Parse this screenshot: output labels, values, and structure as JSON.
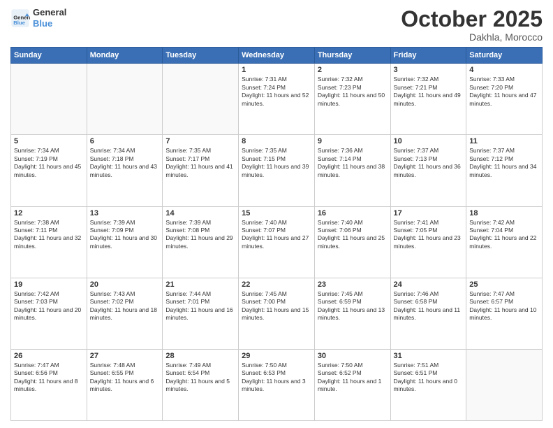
{
  "header": {
    "logo_line1": "General",
    "logo_line2": "Blue",
    "month": "October 2025",
    "location": "Dakhla, Morocco"
  },
  "weekdays": [
    "Sunday",
    "Monday",
    "Tuesday",
    "Wednesday",
    "Thursday",
    "Friday",
    "Saturday"
  ],
  "weeks": [
    [
      {
        "day": "",
        "sunrise": "",
        "sunset": "",
        "daylight": ""
      },
      {
        "day": "",
        "sunrise": "",
        "sunset": "",
        "daylight": ""
      },
      {
        "day": "",
        "sunrise": "",
        "sunset": "",
        "daylight": ""
      },
      {
        "day": "1",
        "sunrise": "Sunrise: 7:31 AM",
        "sunset": "Sunset: 7:24 PM",
        "daylight": "Daylight: 11 hours and 52 minutes."
      },
      {
        "day": "2",
        "sunrise": "Sunrise: 7:32 AM",
        "sunset": "Sunset: 7:23 PM",
        "daylight": "Daylight: 11 hours and 50 minutes."
      },
      {
        "day": "3",
        "sunrise": "Sunrise: 7:32 AM",
        "sunset": "Sunset: 7:21 PM",
        "daylight": "Daylight: 11 hours and 49 minutes."
      },
      {
        "day": "4",
        "sunrise": "Sunrise: 7:33 AM",
        "sunset": "Sunset: 7:20 PM",
        "daylight": "Daylight: 11 hours and 47 minutes."
      }
    ],
    [
      {
        "day": "5",
        "sunrise": "Sunrise: 7:34 AM",
        "sunset": "Sunset: 7:19 PM",
        "daylight": "Daylight: 11 hours and 45 minutes."
      },
      {
        "day": "6",
        "sunrise": "Sunrise: 7:34 AM",
        "sunset": "Sunset: 7:18 PM",
        "daylight": "Daylight: 11 hours and 43 minutes."
      },
      {
        "day": "7",
        "sunrise": "Sunrise: 7:35 AM",
        "sunset": "Sunset: 7:17 PM",
        "daylight": "Daylight: 11 hours and 41 minutes."
      },
      {
        "day": "8",
        "sunrise": "Sunrise: 7:35 AM",
        "sunset": "Sunset: 7:15 PM",
        "daylight": "Daylight: 11 hours and 39 minutes."
      },
      {
        "day": "9",
        "sunrise": "Sunrise: 7:36 AM",
        "sunset": "Sunset: 7:14 PM",
        "daylight": "Daylight: 11 hours and 38 minutes."
      },
      {
        "day": "10",
        "sunrise": "Sunrise: 7:37 AM",
        "sunset": "Sunset: 7:13 PM",
        "daylight": "Daylight: 11 hours and 36 minutes."
      },
      {
        "day": "11",
        "sunrise": "Sunrise: 7:37 AM",
        "sunset": "Sunset: 7:12 PM",
        "daylight": "Daylight: 11 hours and 34 minutes."
      }
    ],
    [
      {
        "day": "12",
        "sunrise": "Sunrise: 7:38 AM",
        "sunset": "Sunset: 7:11 PM",
        "daylight": "Daylight: 11 hours and 32 minutes."
      },
      {
        "day": "13",
        "sunrise": "Sunrise: 7:39 AM",
        "sunset": "Sunset: 7:09 PM",
        "daylight": "Daylight: 11 hours and 30 minutes."
      },
      {
        "day": "14",
        "sunrise": "Sunrise: 7:39 AM",
        "sunset": "Sunset: 7:08 PM",
        "daylight": "Daylight: 11 hours and 29 minutes."
      },
      {
        "day": "15",
        "sunrise": "Sunrise: 7:40 AM",
        "sunset": "Sunset: 7:07 PM",
        "daylight": "Daylight: 11 hours and 27 minutes."
      },
      {
        "day": "16",
        "sunrise": "Sunrise: 7:40 AM",
        "sunset": "Sunset: 7:06 PM",
        "daylight": "Daylight: 11 hours and 25 minutes."
      },
      {
        "day": "17",
        "sunrise": "Sunrise: 7:41 AM",
        "sunset": "Sunset: 7:05 PM",
        "daylight": "Daylight: 11 hours and 23 minutes."
      },
      {
        "day": "18",
        "sunrise": "Sunrise: 7:42 AM",
        "sunset": "Sunset: 7:04 PM",
        "daylight": "Daylight: 11 hours and 22 minutes."
      }
    ],
    [
      {
        "day": "19",
        "sunrise": "Sunrise: 7:42 AM",
        "sunset": "Sunset: 7:03 PM",
        "daylight": "Daylight: 11 hours and 20 minutes."
      },
      {
        "day": "20",
        "sunrise": "Sunrise: 7:43 AM",
        "sunset": "Sunset: 7:02 PM",
        "daylight": "Daylight: 11 hours and 18 minutes."
      },
      {
        "day": "21",
        "sunrise": "Sunrise: 7:44 AM",
        "sunset": "Sunset: 7:01 PM",
        "daylight": "Daylight: 11 hours and 16 minutes."
      },
      {
        "day": "22",
        "sunrise": "Sunrise: 7:45 AM",
        "sunset": "Sunset: 7:00 PM",
        "daylight": "Daylight: 11 hours and 15 minutes."
      },
      {
        "day": "23",
        "sunrise": "Sunrise: 7:45 AM",
        "sunset": "Sunset: 6:59 PM",
        "daylight": "Daylight: 11 hours and 13 minutes."
      },
      {
        "day": "24",
        "sunrise": "Sunrise: 7:46 AM",
        "sunset": "Sunset: 6:58 PM",
        "daylight": "Daylight: 11 hours and 11 minutes."
      },
      {
        "day": "25",
        "sunrise": "Sunrise: 7:47 AM",
        "sunset": "Sunset: 6:57 PM",
        "daylight": "Daylight: 11 hours and 10 minutes."
      }
    ],
    [
      {
        "day": "26",
        "sunrise": "Sunrise: 7:47 AM",
        "sunset": "Sunset: 6:56 PM",
        "daylight": "Daylight: 11 hours and 8 minutes."
      },
      {
        "day": "27",
        "sunrise": "Sunrise: 7:48 AM",
        "sunset": "Sunset: 6:55 PM",
        "daylight": "Daylight: 11 hours and 6 minutes."
      },
      {
        "day": "28",
        "sunrise": "Sunrise: 7:49 AM",
        "sunset": "Sunset: 6:54 PM",
        "daylight": "Daylight: 11 hours and 5 minutes."
      },
      {
        "day": "29",
        "sunrise": "Sunrise: 7:50 AM",
        "sunset": "Sunset: 6:53 PM",
        "daylight": "Daylight: 11 hours and 3 minutes."
      },
      {
        "day": "30",
        "sunrise": "Sunrise: 7:50 AM",
        "sunset": "Sunset: 6:52 PM",
        "daylight": "Daylight: 11 hours and 1 minute."
      },
      {
        "day": "31",
        "sunrise": "Sunrise: 7:51 AM",
        "sunset": "Sunset: 6:51 PM",
        "daylight": "Daylight: 11 hours and 0 minutes."
      },
      {
        "day": "",
        "sunrise": "",
        "sunset": "",
        "daylight": ""
      }
    ]
  ]
}
